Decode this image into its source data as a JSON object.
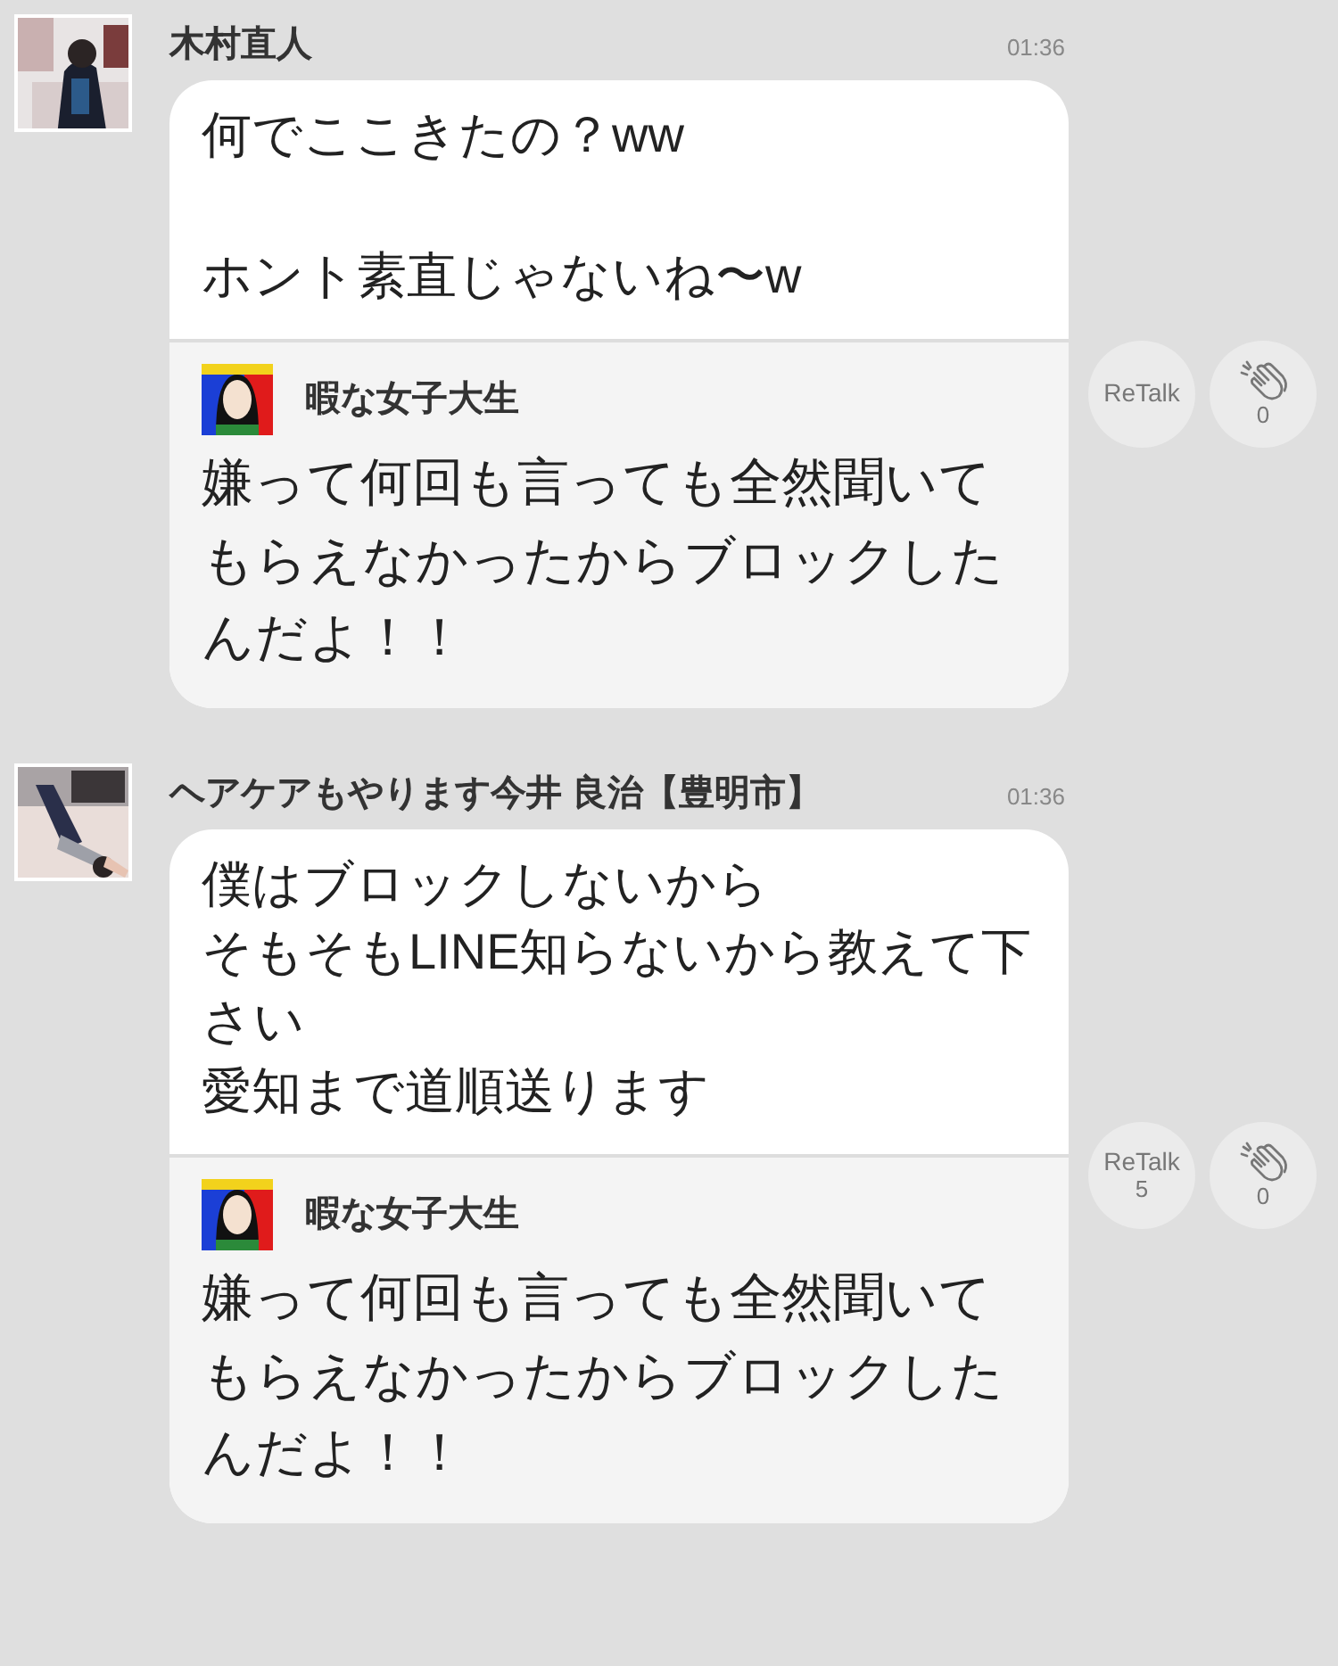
{
  "messages": [
    {
      "sender": "木村直人",
      "time": "01:36",
      "paragraphs": [
        [
          "何でここきたの？ww"
        ],
        [
          "ホント素直じゃないね〜w"
        ]
      ],
      "quote": {
        "author": "暇な女子大生",
        "text": "嫌って何回も言っても全然聞いてもらえなかったからブロックしたんだよ！！"
      },
      "retalk": {
        "label": "ReTalk"
      },
      "clap": {
        "count": "0"
      }
    },
    {
      "sender": "ヘアケアもやります今井 良治【豊明市】",
      "time": "01:36",
      "paragraphs": [
        [
          "僕はブロックしないから",
          "そもそもLINE知らないから教えて下さい",
          "愛知まで道順送ります"
        ]
      ],
      "quote": {
        "author": "暇な女子大生",
        "text": "嫌って何回も言っても全然聞いてもらえなかったからブロックしたんだよ！！"
      },
      "retalk": {
        "label": "ReTalk",
        "count": "5"
      },
      "clap": {
        "count": "0"
      }
    }
  ]
}
